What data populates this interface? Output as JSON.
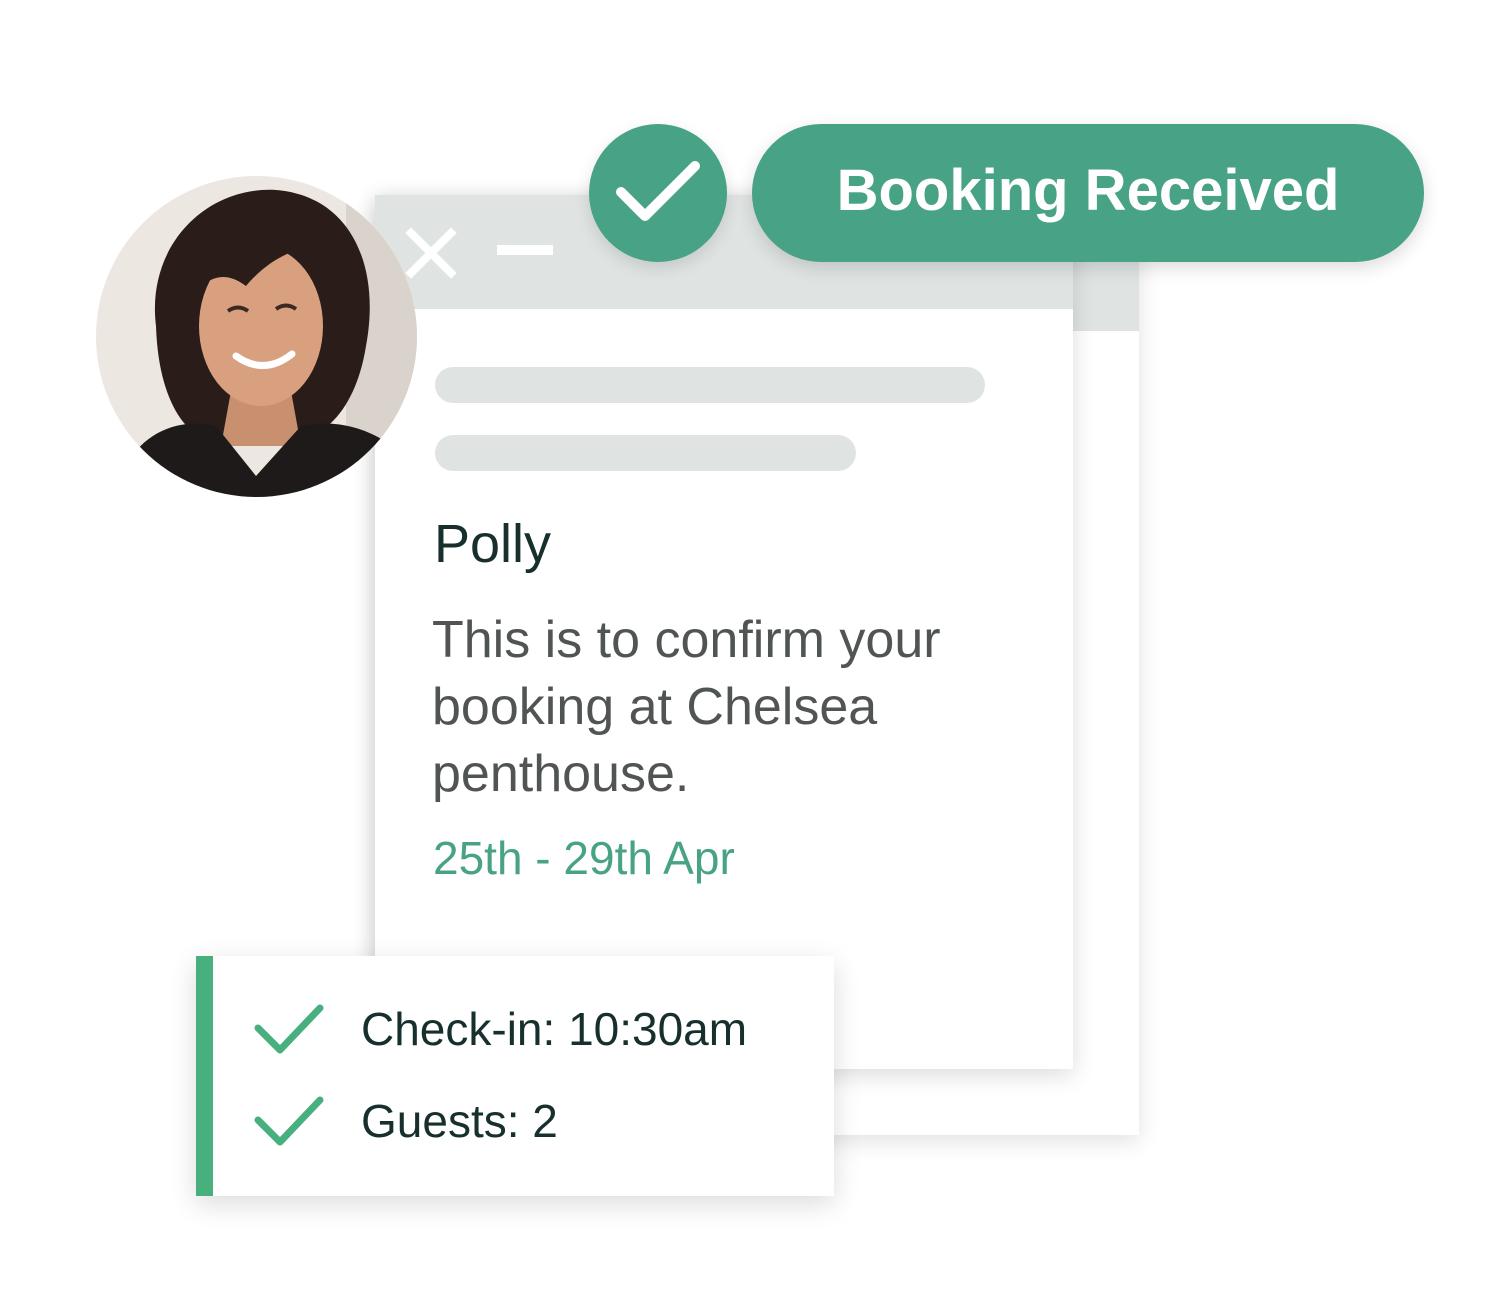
{
  "status": {
    "label": "Booking Received",
    "icon": "check-icon",
    "color": "#48a285"
  },
  "window": {
    "controls": {
      "close_icon": "close-icon",
      "minimize_icon": "minimize-icon"
    },
    "recipient_name": "Polly",
    "message": "This is to confirm your booking at Chelsea penthouse.",
    "dates": "25th - 29th Apr"
  },
  "avatar": {
    "icon": "user-avatar-photo"
  },
  "details": {
    "items": [
      {
        "icon": "check-icon",
        "label": "Check-in: 10:30am"
      },
      {
        "icon": "check-icon",
        "label": "Guests: 2"
      }
    ],
    "accent_color": "#48b07f"
  }
}
